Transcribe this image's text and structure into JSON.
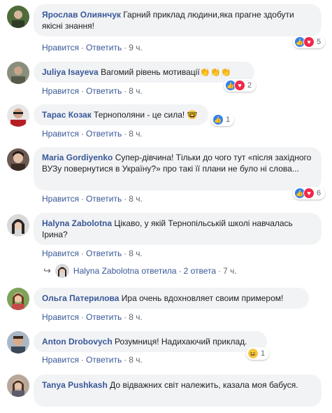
{
  "actions": {
    "like": "Нравится",
    "reply": "Ответить",
    "sep": "·"
  },
  "colors": {
    "author": "#385898",
    "bubble": "#f2f3f5",
    "like": "#2e81f4",
    "love": "#f0284a"
  },
  "comments": [
    {
      "author": "Ярослав Олиянчук",
      "text": "Гарний приклад людини,яка прагне здобути якісні знання!",
      "time": "9 ч.",
      "reactions": [
        "like",
        "love"
      ],
      "count": "5"
    },
    {
      "author": "Juliya Isayeva",
      "text": "Вагомий рівень мотивації👏👏👏",
      "time": "8 ч.",
      "reactions": [
        "like",
        "love"
      ],
      "count": "2"
    },
    {
      "author": "Тарас Козак",
      "text": "Тернополяни - це сила! 🤓",
      "time": "8 ч.",
      "reactions": [
        "like"
      ],
      "count": "1"
    },
    {
      "author": "Maria Gordiyenko",
      "text": "Супер-дівчина! Тільки до чого тут «після західного ВУЗу повернутися в Україну?» про такі її плани не було ні слова...",
      "time": "8 ч.",
      "reactions": [
        "like",
        "love"
      ],
      "count": "6"
    },
    {
      "author": "Halyna Zabolotna",
      "text": "Цікаво, у якій Тернопільській школі навчалась Ірина?",
      "time": "8 ч.",
      "reactions": [],
      "count": ""
    },
    {
      "author": "Ольга Патерилова",
      "text": "Ира очень вдохновляет своим примером!",
      "time": "8 ч.",
      "reactions": [],
      "count": ""
    },
    {
      "author": "Anton Drobovych",
      "text": "Розумниця! Надихаючий приклад.",
      "time": "8 ч.",
      "reactions": [
        "haha"
      ],
      "count": "1"
    },
    {
      "author": "Tanya Pushkash",
      "text": "До відважних світ належить, казала моя бабуся.",
      "time": "8 ч.",
      "reactions": [],
      "count": ""
    }
  ],
  "reply_summary": {
    "name": "Halyna Zabolotna",
    "verb": "ответила",
    "count": "2 ответа",
    "time": "7 ч."
  }
}
